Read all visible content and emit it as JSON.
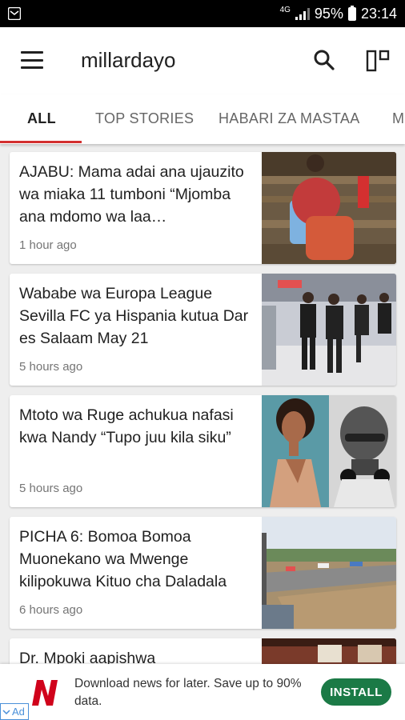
{
  "status_bar": {
    "network": "4G",
    "battery": "95%",
    "time": "23:14"
  },
  "app_bar": {
    "title": "millardayo"
  },
  "tabs": [
    {
      "label": "ALL",
      "active": true
    },
    {
      "label": "TOP STORIES",
      "active": false
    },
    {
      "label": "HABARI ZA MASTAA",
      "active": false
    },
    {
      "label": "M",
      "active": false
    }
  ],
  "articles": [
    {
      "headline": "AJABU: Mama adai ana ujauzito wa miaka 11 tumboni “Mjomba ana mdomo wa laa…",
      "time": "1 hour ago"
    },
    {
      "headline": "Wababe wa Europa League Sevilla FC ya Hispania kutua Dar es Salaam May 21",
      "time": "5 hours ago"
    },
    {
      "headline": "Mtoto wa Ruge achukua nafasi kwa Nandy “Tupo juu kila siku”",
      "time": "5 hours ago"
    },
    {
      "headline": "PICHA 6: Bomoa Bomoa Muonekano wa Mwenge kilipokuwa Kituo cha Daladala",
      "time": "6 hours ago"
    },
    {
      "headline": "Dr. Mpoki aapishwa",
      "time": ""
    }
  ],
  "ad": {
    "text": "Download news for later. Save up to 90% data.",
    "install_label": "INSTALL",
    "badge": "Ad"
  },
  "colors": {
    "accent": "#d32f2f",
    "install_button": "#1b7a46"
  }
}
